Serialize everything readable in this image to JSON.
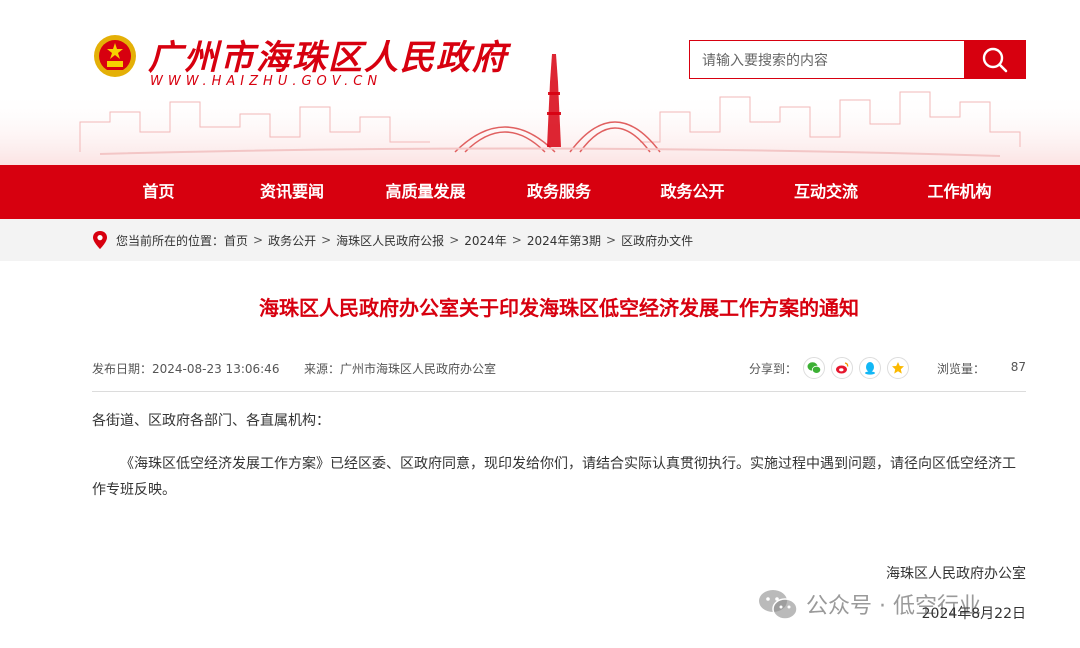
{
  "header": {
    "site_title": "广州市海珠区人民政府",
    "site_url": "WWW.HAIZHU.GOV.CN",
    "search_placeholder": "请输入要搜索的内容"
  },
  "nav": {
    "items": [
      "首页",
      "资讯要闻",
      "高质量发展",
      "政务服务",
      "政务公开",
      "互动交流",
      "工作机构"
    ]
  },
  "breadcrumb": {
    "prefix": "您当前所在的位置：",
    "items": [
      "首页",
      "政务公开",
      "海珠区人民政府公报",
      "2024年",
      "2024年第3期",
      "区政府办文件"
    ],
    "separator": ">"
  },
  "article": {
    "title": "海珠区人民政府办公室关于印发海珠区低空经济发展工作方案的通知",
    "publish_date": "发布日期：2024-08-23 13:06:46",
    "source": "来源：广州市海珠区人民政府办公室",
    "share_label": "分享到：",
    "views_label": "浏览量：",
    "views_count": "87",
    "salutation": "各街道、区政府各部门、各直属机构：",
    "body": "《海珠区低空经济发展工作方案》已经区委、区政府同意，现印发给你们，请结合实际认真贯彻执行。实施过程中遇到问题，请径向区低空经济工作专班反映。",
    "signature": "海珠区人民政府办公室",
    "sign_date": "2024年8月22日"
  },
  "share_icons": [
    "wechat-icon",
    "weibo-icon",
    "qq-icon",
    "qzone-icon"
  ],
  "watermark": "公众号 · 低空行业",
  "colors": {
    "brand_red": "#d7000f",
    "crumb_bg": "#f3f3f3"
  }
}
